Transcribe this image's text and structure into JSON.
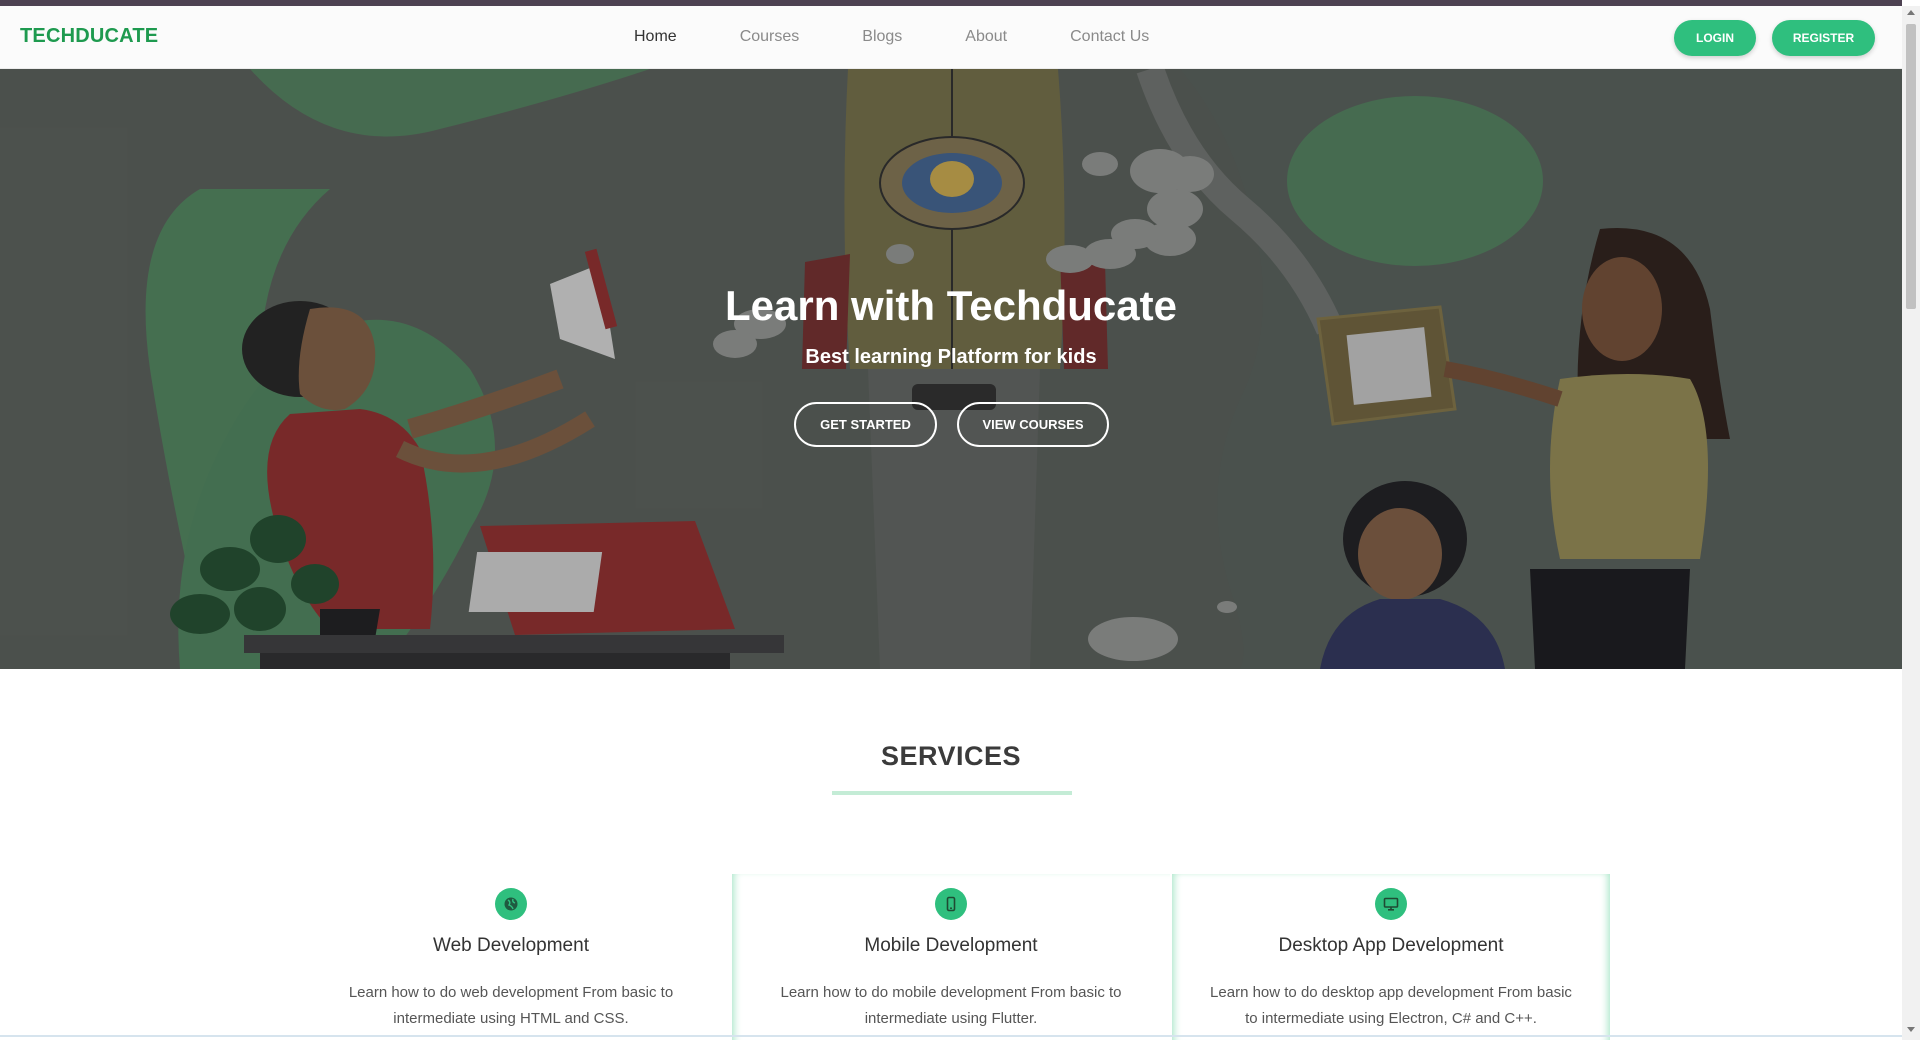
{
  "header": {
    "brand": "TECHDUCATE",
    "nav": [
      "Home",
      "Courses",
      "Blogs",
      "About",
      "Contact Us"
    ],
    "active_nav": "Home",
    "login_label": "LOGIN",
    "register_label": "REGISTER"
  },
  "hero": {
    "title": "Learn with Techducate",
    "subtitle": "Best learning Platform for kids",
    "get_started_label": "GET STARTED",
    "view_courses_label": "VIEW COURSES"
  },
  "services": {
    "title": "SERVICES",
    "cards": [
      {
        "icon": "globe-icon",
        "title": "Web Development",
        "text": "Learn how to do web development From basic to intermediate using HTML and CSS."
      },
      {
        "icon": "mobile-icon",
        "title": "Mobile Development",
        "text": "Learn how to do mobile development From basic to intermediate using Flutter."
      },
      {
        "icon": "desktop-icon",
        "title": "Desktop App Development",
        "text": "Learn how to do desktop app development From basic to intermediate using Electron, C# and C++."
      }
    ]
  },
  "colors": {
    "brand_green": "#1e9a4f",
    "accent_green": "#2fbf7e",
    "hero_bg": "#545a55"
  }
}
